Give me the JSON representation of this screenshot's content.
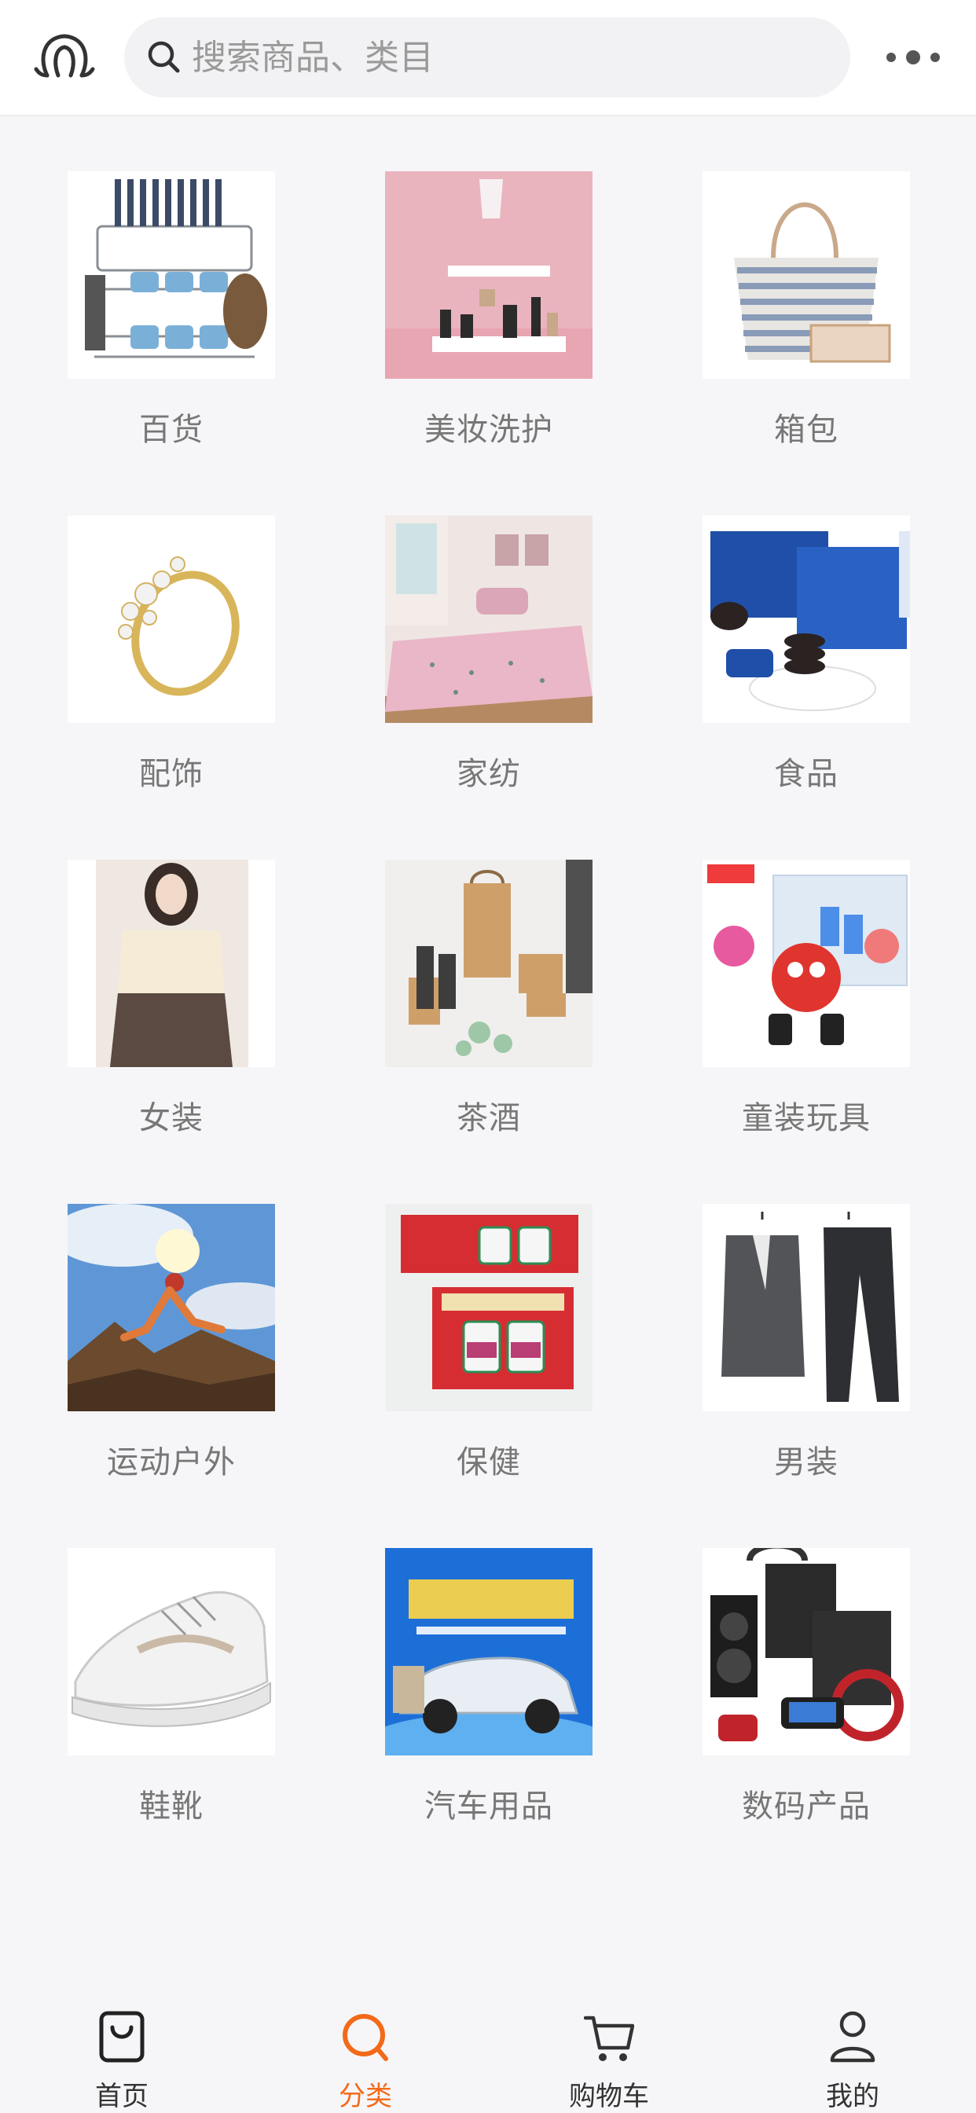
{
  "header": {
    "search_placeholder": "搜索商品、类目",
    "logo_icon": "brand-logo-icon",
    "more_icon": "more-dots-icon"
  },
  "categories": [
    {
      "label": "百货",
      "icon": "dish-rack-image"
    },
    {
      "label": "美妆洗护",
      "icon": "cosmetics-image"
    },
    {
      "label": "箱包",
      "icon": "tote-bag-image"
    },
    {
      "label": "配饰",
      "icon": "ring-image"
    },
    {
      "label": "家纺",
      "icon": "bedding-image"
    },
    {
      "label": "食品",
      "icon": "cookies-image"
    },
    {
      "label": "女装",
      "icon": "womenswear-image"
    },
    {
      "label": "茶酒",
      "icon": "tea-set-image"
    },
    {
      "label": "童装玩具",
      "icon": "toys-image"
    },
    {
      "label": "运动户外",
      "icon": "outdoor-image"
    },
    {
      "label": "保健",
      "icon": "supplement-image"
    },
    {
      "label": "男装",
      "icon": "suit-image"
    },
    {
      "label": "鞋靴",
      "icon": "sneaker-image"
    },
    {
      "label": "汽车用品",
      "icon": "car-image"
    },
    {
      "label": "数码产品",
      "icon": "electronics-image"
    }
  ],
  "tabbar": {
    "items": [
      {
        "label": "首页",
        "icon": "shopping-bag-icon",
        "active": false
      },
      {
        "label": "分类",
        "icon": "search-icon",
        "active": true
      },
      {
        "label": "购物车",
        "icon": "cart-icon",
        "active": false
      },
      {
        "label": "我的",
        "icon": "user-icon",
        "active": false
      }
    ],
    "active_color": "#f36a1b"
  },
  "colors": {
    "background": "#f6f6f8",
    "accent": "#f36a1b",
    "label": "#777777"
  }
}
